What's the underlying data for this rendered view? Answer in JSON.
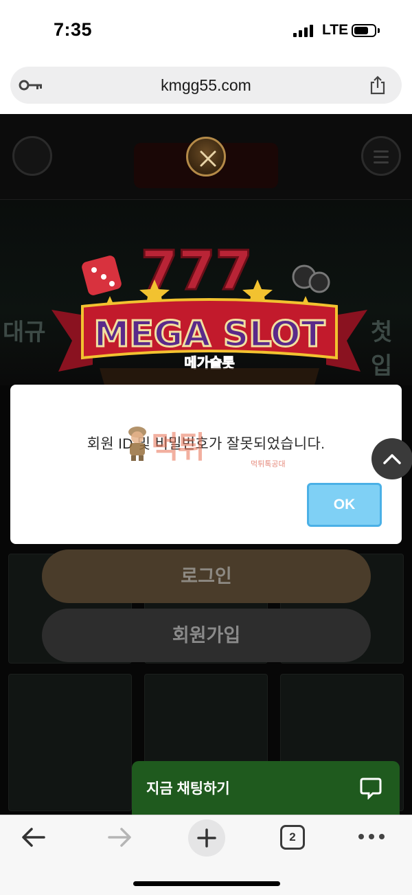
{
  "status_bar": {
    "time": "7:35",
    "network": "LTE"
  },
  "browser": {
    "url": "kmgg55.com",
    "tab_count": "2"
  },
  "site": {
    "logo_text": "MEGA SLOT",
    "logo_subtext": "메가슬롯",
    "banner_left_text": "대규",
    "banner_right_text": "첫입금",
    "login_label": "로그인",
    "signup_label": "회원가입",
    "chat_label": "지금 채팅하기"
  },
  "dialog": {
    "message": "회원 ID 및 비밀번호가 잘못되었습니다.",
    "ok_label": "OK"
  },
  "watermark": {
    "text": "먹튀",
    "subtext": "먹튀톡공대"
  },
  "colors": {
    "ok_button": "#7fd0f5",
    "chat_widget": "#1f5a1e",
    "login_button": "#4a3c2a",
    "signup_button": "#2d2d2d",
    "logo_primary": "#5a2a8a",
    "logo_ribbon": "#c21a2c",
    "logo_gold": "#f2c230"
  }
}
